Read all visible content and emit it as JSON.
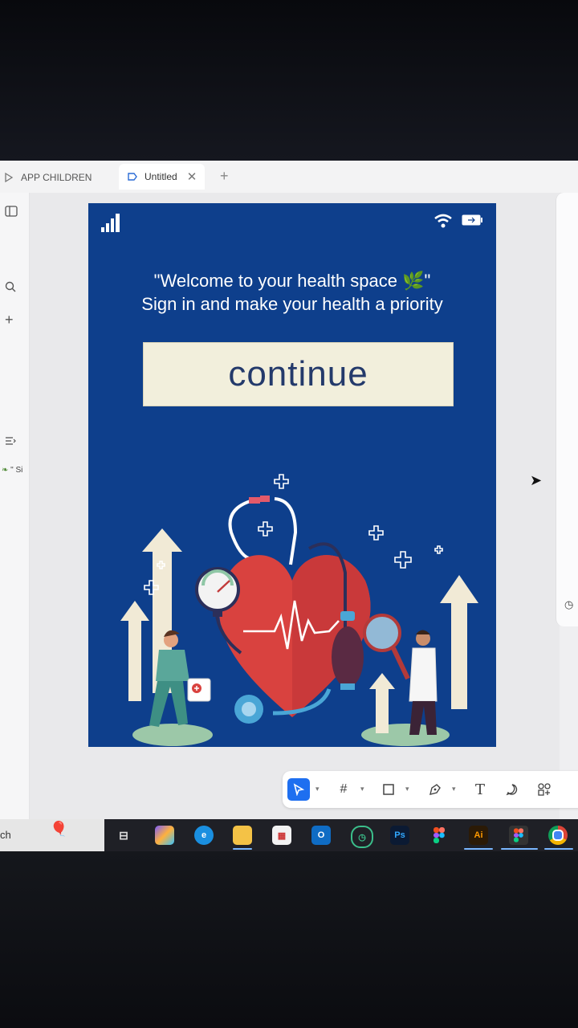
{
  "tabs": [
    {
      "label": "APP CHILDREN"
    },
    {
      "label": "Untitled"
    }
  ],
  "left_panel": {
    "layer_label": "\" Si"
  },
  "frame": {
    "welcome_line1": "\"Welcome to your health space 🌿\"",
    "welcome_line2": "Sign in and make your health a priority",
    "continue_label": "continue"
  },
  "taskbar": {
    "search_text": "ch",
    "ps_label": "Ps",
    "ai_label": "Ai"
  },
  "colors": {
    "frame_bg": "#0e3f8c",
    "button_bg": "#f2efdc",
    "button_text": "#243a6b",
    "heart": "#d9423f",
    "accent_blue": "#1e6ff0"
  },
  "icons": [
    "wifi-icon",
    "battery-icon",
    "signal-icon",
    "search-icon",
    "plus-icon",
    "move-icon",
    "frame-icon",
    "rectangle-icon",
    "pen-icon",
    "text-icon",
    "comment-icon",
    "resources-icon"
  ]
}
